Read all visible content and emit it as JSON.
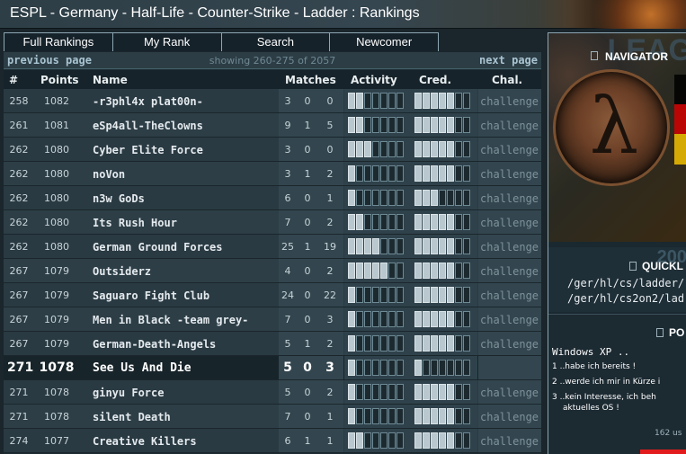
{
  "title": "ESPL - Germany - Half-Life - Counter-Strike - Ladder : Rankings",
  "tabs": [
    {
      "label": "Full Rankings"
    },
    {
      "label": "My Rank"
    },
    {
      "label": "Search"
    },
    {
      "label": "Newcomer"
    }
  ],
  "pager": {
    "prev": "previous page",
    "info": "showing 260-275 of 2057",
    "next": "next page"
  },
  "columns": {
    "rank": "#",
    "points": "Points",
    "name": "Name",
    "matches": "Matches",
    "activity": "Activity",
    "cred": "Cred.",
    "chal": "Chal."
  },
  "rows": [
    {
      "rank": "258",
      "points": "1082",
      "name": "-r3phl4x plat00n-",
      "m1": "3",
      "m2": "0",
      "m3": "0",
      "activity": 2,
      "cred": 5,
      "chal": "challenge"
    },
    {
      "rank": "261",
      "points": "1081",
      "name": "eSp4all-TheClowns",
      "m1": "9",
      "m2": "1",
      "m3": "5",
      "activity": 2,
      "cred": 5,
      "chal": "challenge"
    },
    {
      "rank": "262",
      "points": "1080",
      "name": "Cyber Elite Force",
      "m1": "3",
      "m2": "0",
      "m3": "0",
      "activity": 3,
      "cred": 5,
      "chal": "challenge"
    },
    {
      "rank": "262",
      "points": "1080",
      "name": "noVon",
      "m1": "3",
      "m2": "1",
      "m3": "2",
      "activity": 1,
      "cred": 5,
      "chal": "challenge"
    },
    {
      "rank": "262",
      "points": "1080",
      "name": "n3w GoDs",
      "m1": "6",
      "m2": "0",
      "m3": "1",
      "activity": 1,
      "cred": 3,
      "chal": "challenge"
    },
    {
      "rank": "262",
      "points": "1080",
      "name": "Its Rush Hour",
      "m1": "7",
      "m2": "0",
      "m3": "2",
      "activity": 2,
      "cred": 5,
      "chal": "challenge"
    },
    {
      "rank": "262",
      "points": "1080",
      "name": "German Ground Forces",
      "m1": "25",
      "m2": "1",
      "m3": "19",
      "activity": 4,
      "cred": 5,
      "chal": "challenge"
    },
    {
      "rank": "267",
      "points": "1079",
      "name": "Outsiderz",
      "m1": "4",
      "m2": "0",
      "m3": "2",
      "activity": 5,
      "cred": 5,
      "chal": "challenge"
    },
    {
      "rank": "267",
      "points": "1079",
      "name": "Saguaro Fight Club",
      "m1": "24",
      "m2": "0",
      "m3": "22",
      "activity": 1,
      "cred": 5,
      "chal": "challenge"
    },
    {
      "rank": "267",
      "points": "1079",
      "name": "Men in Black -team grey-",
      "m1": "7",
      "m2": "0",
      "m3": "3",
      "activity": 1,
      "cred": 5,
      "chal": "challenge"
    },
    {
      "rank": "267",
      "points": "1079",
      "name": "German-Death-Angels",
      "m1": "5",
      "m2": "1",
      "m3": "2",
      "activity": 1,
      "cred": 5,
      "chal": "challenge"
    },
    {
      "rank": "271",
      "points": "1078",
      "name": "See Us And Die",
      "m1": "5",
      "m2": "0",
      "m3": "3",
      "activity": 1,
      "cred": 1,
      "chal": "",
      "highlight": true
    },
    {
      "rank": "271",
      "points": "1078",
      "name": "ginyu Force",
      "m1": "5",
      "m2": "0",
      "m3": "2",
      "activity": 1,
      "cred": 5,
      "chal": "challenge"
    },
    {
      "rank": "271",
      "points": "1078",
      "name": "silent Death",
      "m1": "7",
      "m2": "0",
      "m3": "1",
      "activity": 1,
      "cred": 5,
      "chal": "challenge"
    },
    {
      "rank": "274",
      "points": "1077",
      "name": "Creative Killers",
      "m1": "6",
      "m2": "1",
      "m3": "1",
      "activity": 2,
      "cred": 5,
      "chal": "challenge"
    }
  ],
  "side": {
    "leag": "LEAG",
    "navigator_label": "NAVIGATOR",
    "year": "200",
    "quick_label": "QUICKL",
    "quick_links": [
      "/ger/hl/cs/ladder/",
      "/ger/hl/cs2on2/lad"
    ],
    "poll_label": "PO",
    "poll_question": "Windows XP ..",
    "poll_options": [
      "1 ..habe ich bereits !",
      "2 ..werde ich mir in Kürze i",
      "3 ..kein Interesse, ich beh",
      "aktuelles OS !"
    ],
    "poll_votes": "162 us"
  },
  "colors": {
    "bar_on": "#b9c8ce",
    "bar_off": "#1c2a30",
    "accent": "#a9c4d1",
    "poll_bar": "#e21c1c"
  }
}
